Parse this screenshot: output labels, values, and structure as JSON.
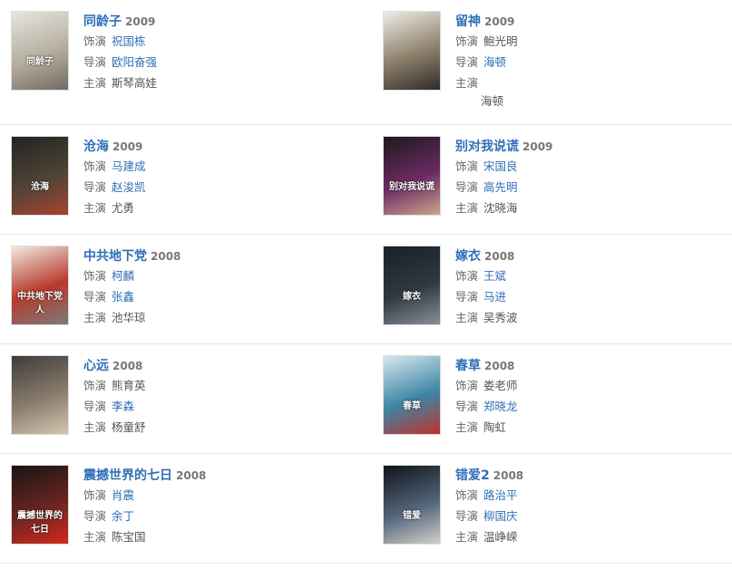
{
  "labels": {
    "actor": "饰演",
    "director": "导演",
    "lead": "主演"
  },
  "rows": [
    [
      {
        "title": "同龄子",
        "year": "2009",
        "actor": "祝国栋",
        "director": "欧阳奋强",
        "lead": "斯琴高娃",
        "poster": [
          "#e8e5df",
          "#b5aea0",
          "#726b62"
        ],
        "poster_text": "同龄子",
        "actor_link": true,
        "director_link": true
      },
      {
        "title": "留神",
        "year": "2009",
        "actor": "鲍光明",
        "director": "海顿",
        "lead": "",
        "lead_sub": "海顿",
        "poster": [
          "#efece7",
          "#8d7f6a",
          "#2e2c2a"
        ],
        "poster_text": "",
        "actor_link": false,
        "director_link": true
      }
    ],
    [
      {
        "title": "沧海",
        "year": "2009",
        "actor": "马建成",
        "director": "赵浚凯",
        "lead": "尤勇",
        "poster": [
          "#232323",
          "#4e4436",
          "#a8432f"
        ],
        "poster_text": "沧海",
        "actor_link": true,
        "director_link": true
      },
      {
        "title": "别对我说谎",
        "year": "2009",
        "actor": "宋国良",
        "director": "高先明",
        "lead": "沈晓海",
        "poster": [
          "#1d1a1d",
          "#6d2a63",
          "#caa58b"
        ],
        "poster_text": "别对我说谎",
        "actor_link": true,
        "director_link": true
      }
    ],
    [
      {
        "title": "中共地下党",
        "year": "2008",
        "actor": "柯麟",
        "director": "张鑫",
        "lead": "池华琼",
        "poster": [
          "#f2eadf",
          "#b63a2d",
          "#7b7b7b"
        ],
        "poster_text": "中共地下党人",
        "actor_link": true,
        "director_link": true
      },
      {
        "title": "嫁衣",
        "year": "2008",
        "actor": "王斌",
        "director": "马进",
        "lead": "吴秀波",
        "poster": [
          "#182028",
          "#2f3942",
          "#8a8f96"
        ],
        "poster_text": "嫁衣",
        "actor_link": true,
        "director_link": true
      }
    ],
    [
      {
        "title": "心远",
        "year": "2008",
        "actor": "熊育英",
        "director": "李森",
        "lead": "杨童舒",
        "poster": [
          "#3d3c3a",
          "#8a7c6c",
          "#d5c6b2"
        ],
        "poster_text": "",
        "actor_link": false,
        "director_link": true
      },
      {
        "title": "春草",
        "year": "2008",
        "actor": "娄老师",
        "director": "郑晓龙",
        "lead": "陶虹",
        "poster": [
          "#d9e7ee",
          "#3c85a4",
          "#c1312e"
        ],
        "poster_text": "春草",
        "actor_link": false,
        "director_link": true
      }
    ],
    [
      {
        "title": "震撼世界的七日",
        "year": "2008",
        "actor": "肖震",
        "director": "余丁",
        "lead": "陈宝国",
        "poster": [
          "#171515",
          "#6a2521",
          "#d22a1e"
        ],
        "poster_text": "震撼世界的七日",
        "actor_link": true,
        "director_link": true
      },
      {
        "title": "错爱2",
        "year": "2008",
        "actor": "路治平",
        "director": "柳国庆",
        "lead": "温峥嵘",
        "poster": [
          "#101318",
          "#52657a",
          "#d4d0c9"
        ],
        "poster_text": "错爱",
        "actor_link": true,
        "director_link": true
      }
    ]
  ]
}
